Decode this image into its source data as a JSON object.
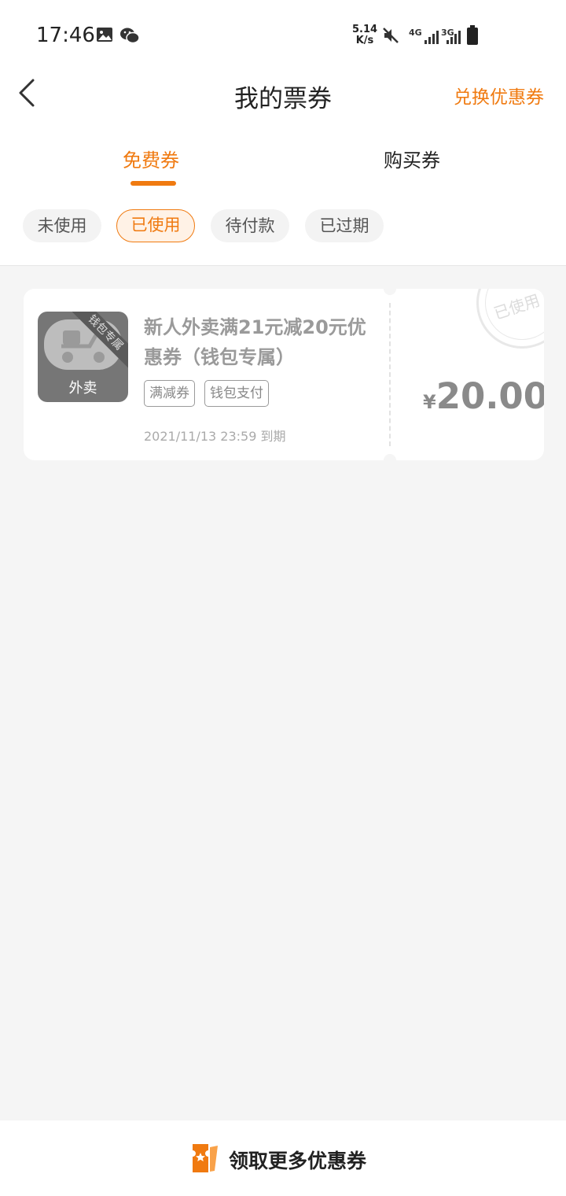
{
  "status_bar": {
    "time": "17:46",
    "net_speed_value": "5.14",
    "net_speed_unit": "K/s",
    "network_1": "4G",
    "network_2": "3G"
  },
  "header": {
    "title": "我的票券",
    "action_label": "兑换优惠券"
  },
  "tabs": [
    {
      "label": "免费券",
      "active": true
    },
    {
      "label": "购买券",
      "active": false
    }
  ],
  "filters": [
    {
      "label": "未使用",
      "active": false
    },
    {
      "label": "已使用",
      "active": true
    },
    {
      "label": "待付款",
      "active": false
    },
    {
      "label": "已过期",
      "active": false
    }
  ],
  "coupon": {
    "thumb_ribbon": "钱包专属",
    "thumb_label": "外卖",
    "name": "新人外卖满21元减20元优惠券（钱包专属）",
    "tags": [
      "满减券",
      "钱包支付"
    ],
    "expiry": "2021/11/13 23:59 到期",
    "currency": "¥",
    "amount": "20.00",
    "stamp": "已使用"
  },
  "bottom_bar": {
    "label": "领取更多优惠券"
  },
  "colors": {
    "accent": "#f07a10",
    "background": "#f5f5f5"
  }
}
